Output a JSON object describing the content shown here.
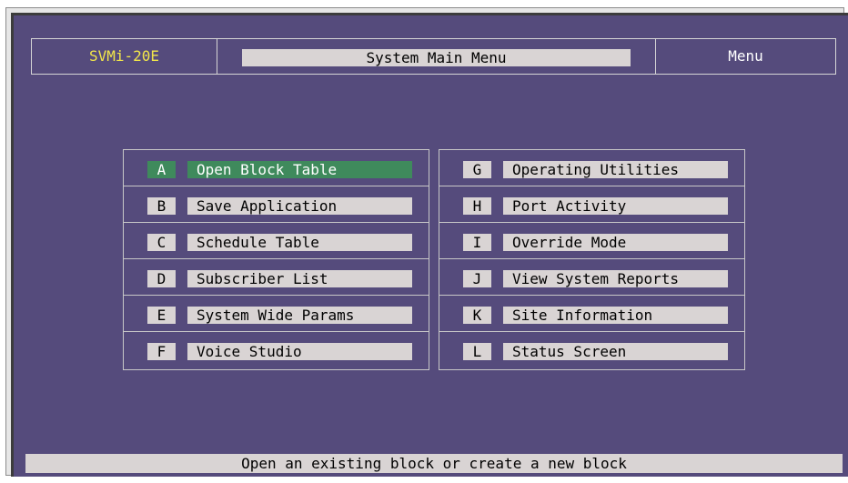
{
  "header": {
    "model": "SVMi-20E",
    "title": "System Main Menu",
    "mode": "Menu"
  },
  "menu_left": [
    {
      "key": "A",
      "label": "Open Block Table",
      "selected": true
    },
    {
      "key": "B",
      "label": "Save Application",
      "selected": false
    },
    {
      "key": "C",
      "label": "Schedule Table",
      "selected": false
    },
    {
      "key": "D",
      "label": "Subscriber List",
      "selected": false
    },
    {
      "key": "E",
      "label": "System Wide Params",
      "selected": false
    },
    {
      "key": "F",
      "label": "Voice Studio",
      "selected": false
    }
  ],
  "menu_right": [
    {
      "key": "G",
      "label": "Operating Utilities",
      "selected": false
    },
    {
      "key": "H",
      "label": "Port Activity",
      "selected": false
    },
    {
      "key": "I",
      "label": "Override Mode",
      "selected": false
    },
    {
      "key": "J",
      "label": "View System Reports",
      "selected": false
    },
    {
      "key": "K",
      "label": "Site Information",
      "selected": false
    },
    {
      "key": "L",
      "label": "Status Screen",
      "selected": false
    }
  ],
  "status": "Open an existing block or create a new block",
  "colors": {
    "background": "#554b7c",
    "model_text": "#f2e64a",
    "selected": "#3f8a5c",
    "item_box": "#d9d4d4"
  }
}
